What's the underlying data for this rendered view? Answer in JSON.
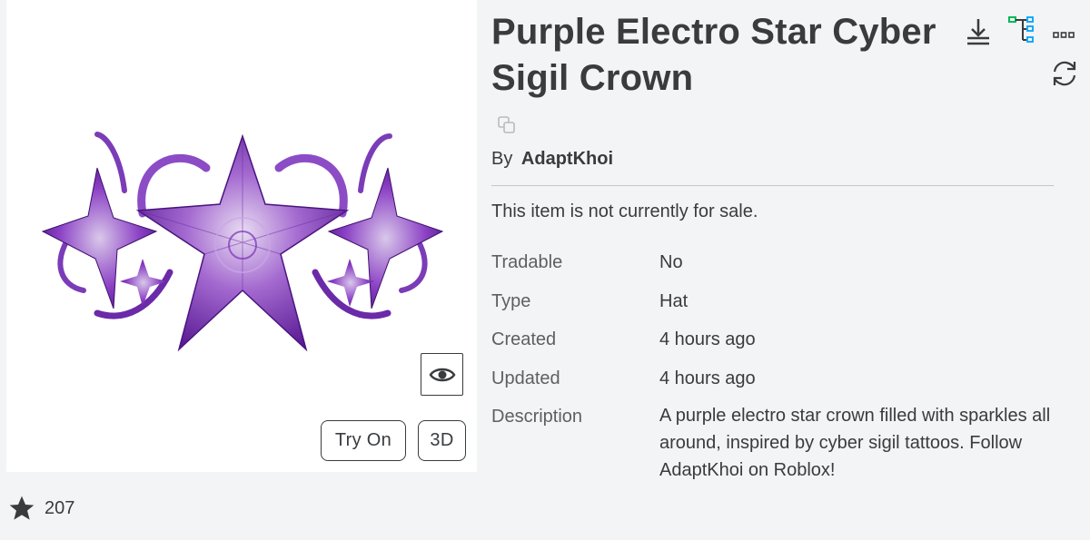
{
  "item": {
    "title": "Purple Electro Star Cyber Sigil Crown",
    "by_label": "By",
    "creator": "AdaptKhoi",
    "sale_status": "This item is not currently for sale."
  },
  "details": {
    "tradable": {
      "label": "Tradable",
      "value": "No"
    },
    "type": {
      "label": "Type",
      "value": "Hat"
    },
    "created": {
      "label": "Created",
      "value": "4 hours ago"
    },
    "updated": {
      "label": "Updated",
      "value": "4 hours ago"
    },
    "description": {
      "label": "Description",
      "value": "A purple electro star crown filled with sparkles all around, inspired by cyber sigil tattoos. Follow AdaptKhoi on Roblox!"
    }
  },
  "thumbnail": {
    "try_on_label": "Try On",
    "three_d_label": "3D"
  },
  "favorites": {
    "count": "207"
  },
  "icons": {
    "download": "download-icon",
    "tree": "tree-view-icon",
    "more": "more-options-icon",
    "refresh": "refresh-icon",
    "copy": "copy-icon",
    "eye": "eye-icon",
    "star": "star-icon"
  },
  "colors": {
    "background": "#f2f4f5",
    "text": "#393b3d",
    "accent_green": "#02b757",
    "accent_blue": "#00a2ff",
    "crown_purple": "#7b2fbf"
  }
}
